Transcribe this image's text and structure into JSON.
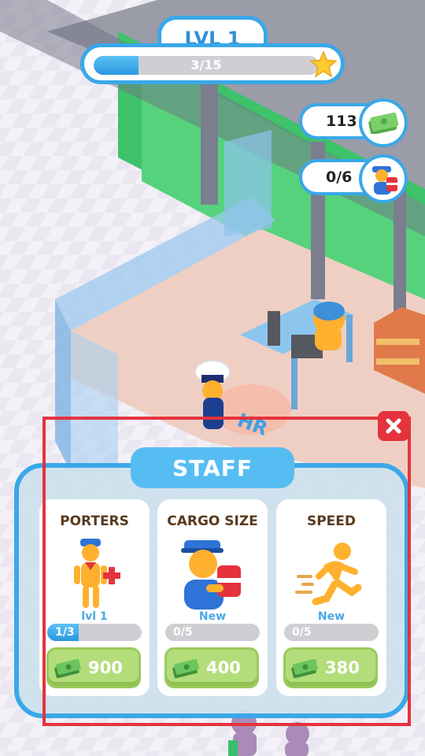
{
  "hud": {
    "level_label": "LVL 1",
    "xp_text": "3/15",
    "xp_progress": 0.2,
    "money": "113",
    "cargo": "0/6"
  },
  "panel": {
    "title": "STAFF",
    "cards": [
      {
        "title": "PORTERS",
        "level": "lvl 1",
        "progress_text": "1/3",
        "progress": 0.333,
        "price": "900",
        "icon": "porter-icon"
      },
      {
        "title": "CARGO SIZE",
        "level": "New",
        "progress_text": "0/5",
        "progress": 0,
        "price": "400",
        "icon": "cargo-icon"
      },
      {
        "title": "SPEED",
        "level": "New",
        "progress_text": "0/5",
        "progress": 0,
        "price": "380",
        "icon": "runner-icon"
      }
    ]
  },
  "scene_sign": "HR",
  "colors": {
    "accent": "#3aa8e8",
    "close": "#e4333d",
    "buy": "#b3dd7a",
    "title_brown": "#5a3a1e"
  }
}
